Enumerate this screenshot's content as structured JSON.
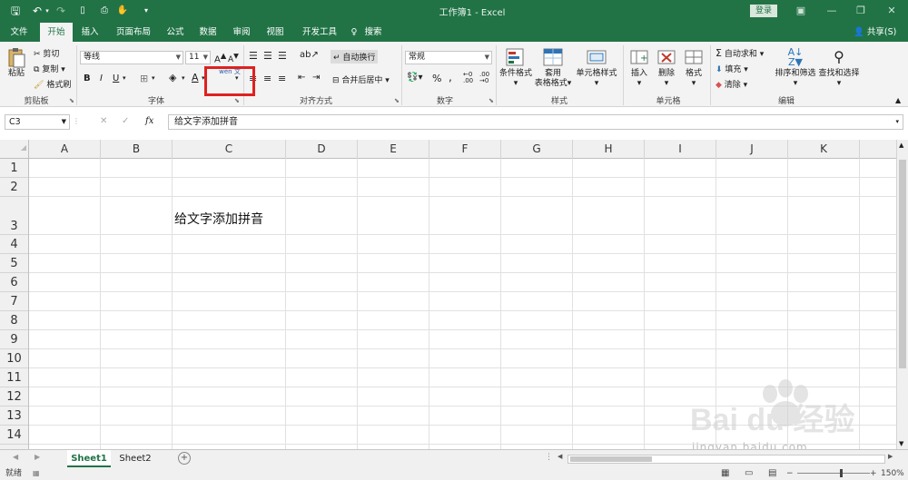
{
  "app": {
    "window_title": "工作簿1  -  Excel",
    "login_label": "登录"
  },
  "tabs": [
    {
      "label": "文件"
    },
    {
      "label": "开始"
    },
    {
      "label": "插入"
    },
    {
      "label": "页面布局"
    },
    {
      "label": "公式"
    },
    {
      "label": "数据"
    },
    {
      "label": "审阅"
    },
    {
      "label": "视图"
    },
    {
      "label": "开发工具"
    }
  ],
  "tell_me": "搜索",
  "share_label": "共享(S)",
  "ribbon": {
    "clipboard": {
      "paste": "粘贴",
      "cut": "剪切",
      "copy": "复制",
      "format_painter": "格式刷",
      "group": "剪贴板"
    },
    "font": {
      "name": "等线",
      "size": "11",
      "bold": "B",
      "italic": "I",
      "underline": "U",
      "group": "字体",
      "phonetic": "wén 文"
    },
    "alignment": {
      "wrap": "自动换行",
      "merge": "合并后居中",
      "group": "对齐方式"
    },
    "number": {
      "format": "常规",
      "percent": "%",
      "comma": ",",
      "group": "数字"
    },
    "styles": {
      "conditional": "条件格式",
      "table_1": "套用",
      "table_2": "表格格式",
      "cell_style": "单元格样式",
      "group": "样式"
    },
    "cells": {
      "insert": "插入",
      "delete": "删除",
      "format": "格式",
      "group": "单元格"
    },
    "editing": {
      "autosum": "自动求和",
      "fill": "填充",
      "clear": "清除",
      "sort": "排序和筛选",
      "find": "查找和选择",
      "group": "编辑"
    }
  },
  "formula_bar": {
    "name_box": "C3",
    "fx": "fx",
    "content": "给文字添加拼音"
  },
  "columns": [
    "A",
    "B",
    "C",
    "D",
    "E",
    "F",
    "G",
    "H",
    "I",
    "J",
    "K"
  ],
  "rows": [
    "1",
    "2",
    "3",
    "4",
    "5",
    "6",
    "7",
    "8",
    "9",
    "10",
    "11",
    "12",
    "13",
    "14"
  ],
  "cells": {
    "C3": "给文字添加拼音"
  },
  "sheets": {
    "sheet1": "Sheet1",
    "sheet2": "Sheet2",
    "add": "+"
  },
  "status": {
    "ready": "就绪",
    "zoom": "150%"
  },
  "watermark": {
    "brand": "Bai du 经验",
    "url": "jingyan.baidu.com"
  },
  "colors": {
    "excel_green": "#217346",
    "highlight_red": "#e02020"
  }
}
